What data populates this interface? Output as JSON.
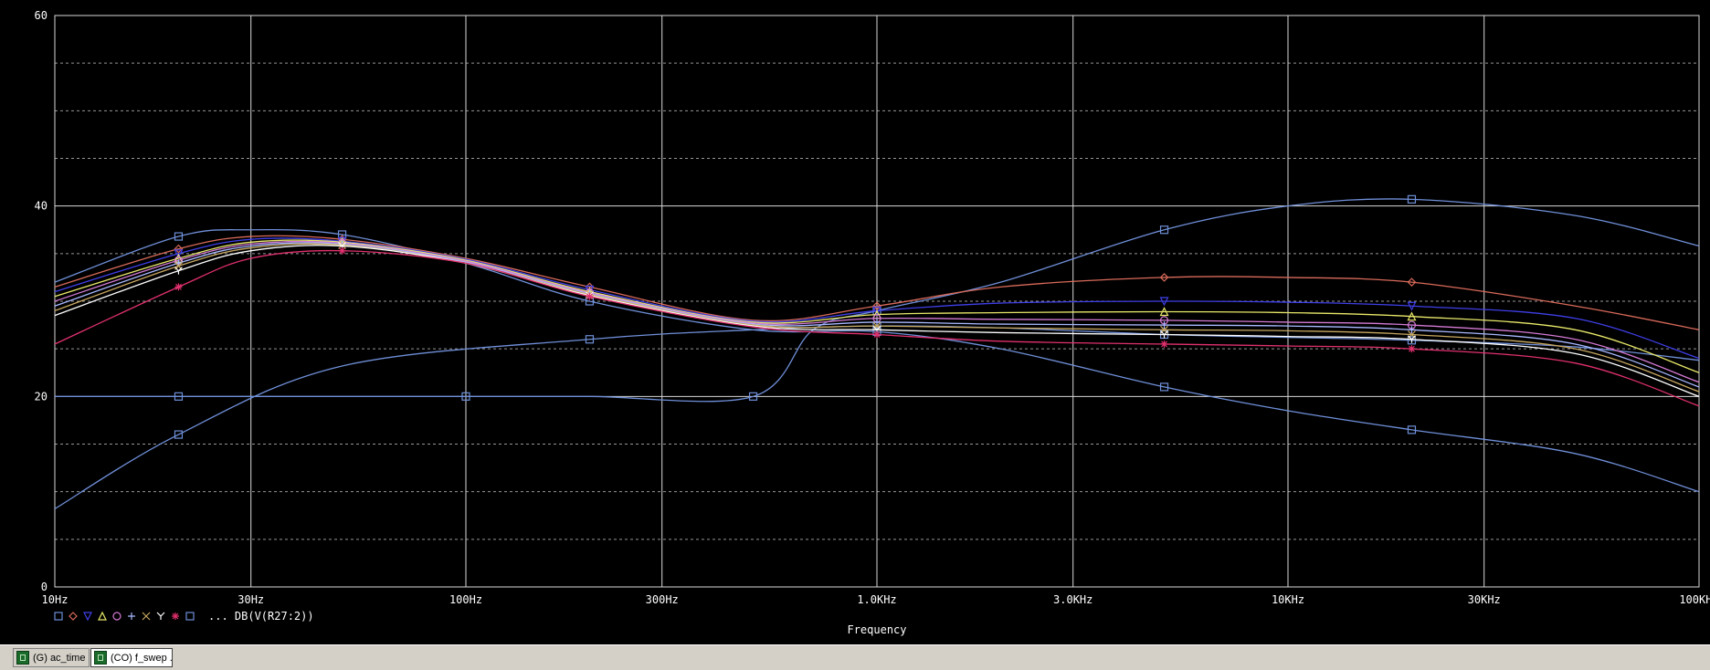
{
  "window": {
    "tabs": [
      {
        "label": "(G) ac_time",
        "active": false,
        "icon": "schematic-icon"
      },
      {
        "label": "(CO) f_swep ...",
        "active": true,
        "icon": "schematic-icon"
      }
    ]
  },
  "colors": {
    "background": "#000000",
    "grid": "#d8d8d8",
    "text": "#ffffff"
  },
  "chart_data": {
    "type": "line",
    "xlabel": "Frequency",
    "ylabel": "",
    "x_scale": "log",
    "xlim": [
      10,
      100000
    ],
    "ylim": [
      0,
      60
    ],
    "x_ticks": [
      10,
      30,
      100,
      300,
      1000,
      3000,
      10000,
      30000,
      100000
    ],
    "x_tick_labels": [
      "10Hz",
      "30Hz",
      "100Hz",
      "300Hz",
      "1.0KHz",
      "3.0KHz",
      "10KHz",
      "30KHz",
      "100KHz"
    ],
    "y_ticks": [
      0,
      20,
      40,
      60
    ],
    "y_tick_labels": [
      "0",
      "20",
      "40",
      "60"
    ],
    "grid": true,
    "legend_placement": "bottom-left",
    "legend_text": "... DB(V(R27:2))",
    "series": [
      {
        "color": "#6f8fd8",
        "marker": "square",
        "x": [
          10,
          20,
          50,
          200,
          500,
          1000,
          2000,
          5000,
          10000,
          20000,
          50000,
          100000
        ],
        "y": [
          8.2,
          16,
          23.2,
          26,
          27,
          27.4,
          27.2,
          26.5,
          26.2,
          25.9,
          25.2,
          23.8
        ]
      },
      {
        "color": "#6f8fd8",
        "marker": "square",
        "x": [
          10,
          20,
          30,
          50,
          100,
          200,
          500,
          1000,
          2000,
          5000,
          10000,
          20000,
          50000,
          100000
        ],
        "y": [
          32,
          36.8,
          37.5,
          37,
          34,
          30,
          27,
          26.8,
          25,
          21,
          18.5,
          16.5,
          14,
          10
        ]
      },
      {
        "color": "#6f8fd8",
        "marker": "square",
        "x": [
          10,
          20,
          50,
          100,
          200,
          500,
          700,
          1000,
          2000,
          5000,
          10000,
          20000,
          50000,
          100000
        ],
        "y": [
          20,
          20,
          20,
          20,
          20,
          20,
          27,
          29,
          32,
          37.5,
          40,
          40.7,
          39,
          35.8
        ]
      },
      {
        "color": "#d86a5a",
        "marker": "diamond",
        "x": [
          10,
          20,
          30,
          50,
          100,
          200,
          500,
          1000,
          2000,
          5000,
          10000,
          20000,
          50000,
          100000
        ],
        "y": [
          31.5,
          35.5,
          36.8,
          36.5,
          34.5,
          31.5,
          28,
          29.5,
          31.5,
          32.5,
          32.5,
          32,
          29.5,
          27
        ]
      },
      {
        "color": "#3f3fe8",
        "marker": "triangle-down",
        "x": [
          10,
          20,
          30,
          50,
          100,
          200,
          500,
          1000,
          2000,
          5000,
          10000,
          20000,
          50000,
          100000
        ],
        "y": [
          31,
          35,
          36.5,
          36.3,
          34.4,
          31.2,
          27.9,
          29,
          29.8,
          30,
          29.9,
          29.5,
          28.2,
          24
        ]
      },
      {
        "color": "#e8e86a",
        "marker": "triangle-up",
        "x": [
          10,
          20,
          30,
          50,
          100,
          200,
          500,
          1000,
          2000,
          5000,
          10000,
          20000,
          50000,
          100000
        ],
        "y": [
          30.5,
          34.5,
          36.2,
          36.2,
          34.3,
          31,
          27.8,
          28.6,
          28.8,
          28.9,
          28.8,
          28.4,
          27,
          22.5
        ]
      },
      {
        "color": "#d47ad4",
        "marker": "circle",
        "x": [
          10,
          20,
          30,
          50,
          100,
          200,
          500,
          1000,
          2000,
          5000,
          10000,
          20000,
          50000,
          100000
        ],
        "y": [
          30,
          34.3,
          36,
          36.1,
          34.2,
          30.9,
          27.7,
          28.2,
          28.1,
          28,
          27.8,
          27.5,
          26,
          21.5
        ]
      },
      {
        "color": "#a8b8ff",
        "marker": "plus",
        "x": [
          10,
          20,
          30,
          50,
          100,
          200,
          500,
          1000,
          2000,
          5000,
          10000,
          20000,
          50000,
          100000
        ],
        "y": [
          29.5,
          34,
          35.8,
          36,
          34.1,
          30.8,
          27.6,
          27.8,
          27.6,
          27.5,
          27.4,
          27,
          25.5,
          21
        ]
      },
      {
        "color": "#c8a860",
        "marker": "x",
        "x": [
          10,
          20,
          30,
          50,
          100,
          200,
          500,
          1000,
          2000,
          5000,
          10000,
          20000,
          50000,
          100000
        ],
        "y": [
          29,
          33.7,
          35.6,
          35.9,
          34,
          30.7,
          27.5,
          27.4,
          27.2,
          27,
          26.9,
          26.5,
          25,
          20.5
        ]
      },
      {
        "color": "#ffffff",
        "marker": "y",
        "x": [
          10,
          20,
          30,
          50,
          100,
          200,
          500,
          1000,
          2000,
          5000,
          10000,
          20000,
          50000,
          100000
        ],
        "y": [
          28.5,
          33.2,
          35.3,
          35.8,
          34,
          30.6,
          27.4,
          27,
          26.7,
          26.5,
          26.3,
          26,
          24.5,
          20
        ]
      },
      {
        "color": "#e0306e",
        "marker": "asterisk",
        "x": [
          10,
          20,
          30,
          50,
          100,
          200,
          500,
          1000,
          2000,
          5000,
          10000,
          20000,
          50000,
          100000
        ],
        "y": [
          25.5,
          31.5,
          34.5,
          35.3,
          34,
          30.5,
          27.3,
          26.5,
          25.8,
          25.5,
          25.3,
          25,
          23.5,
          19
        ]
      }
    ]
  }
}
